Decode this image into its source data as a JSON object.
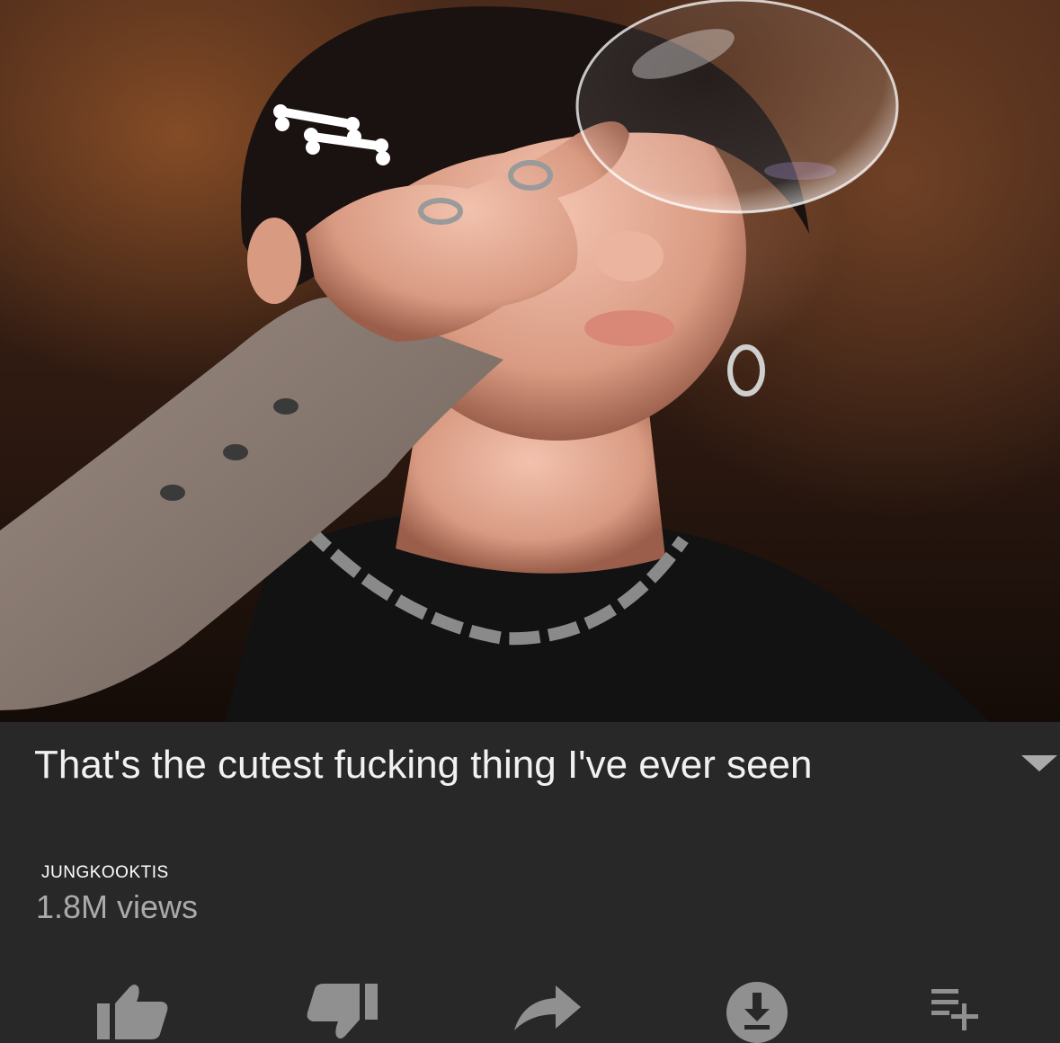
{
  "video": {
    "title": "That's the cutest fucking thing I've ever seen",
    "channel": "JUNGKOOKTIS",
    "views": "1.8M views"
  },
  "thumbnail": {
    "description_icons": [
      "bone-clip-icon",
      "bubble-icon"
    ]
  },
  "actions": [
    {
      "name": "like",
      "icon": "thumbs-up-icon"
    },
    {
      "name": "dislike",
      "icon": "thumbs-down-icon"
    },
    {
      "name": "share",
      "icon": "share-icon"
    },
    {
      "name": "download",
      "icon": "download-icon"
    },
    {
      "name": "save",
      "icon": "add-to-playlist-icon"
    }
  ],
  "colors": {
    "panel_bg": "#282828",
    "title_text": "#f1f1f1",
    "secondary_text": "#aaaaaa",
    "icon_color": "#909090"
  }
}
